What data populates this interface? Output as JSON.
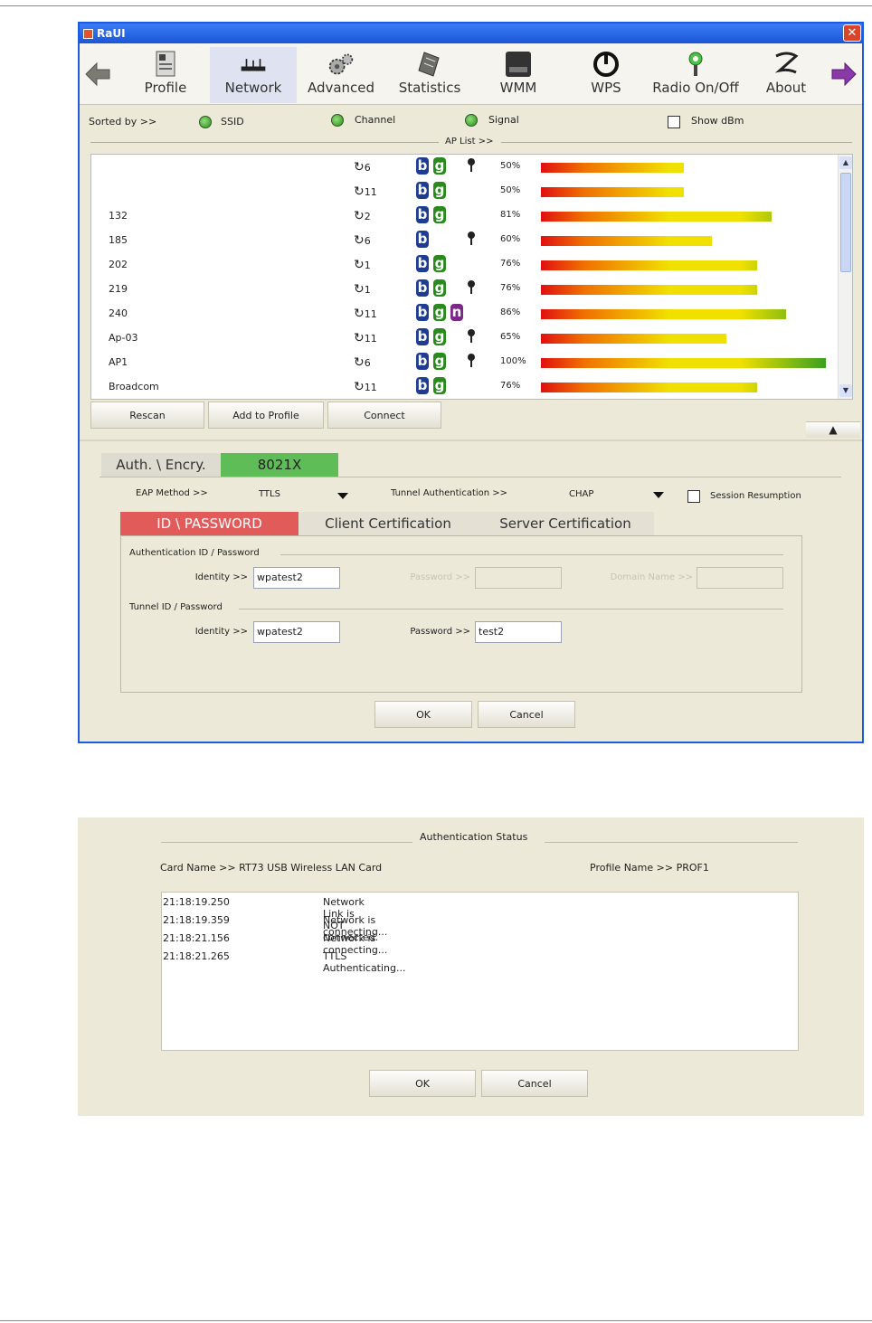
{
  "window": {
    "title": "RaUI",
    "close_glyph": "✕"
  },
  "toolbar": {
    "items": [
      {
        "label": "Profile",
        "icon": "profile-icon"
      },
      {
        "label": "Network",
        "icon": "network-icon",
        "active": true
      },
      {
        "label": "Advanced",
        "icon": "advanced-icon"
      },
      {
        "label": "Statistics",
        "icon": "statistics-icon"
      },
      {
        "label": "WMM",
        "icon": "wmm-icon"
      },
      {
        "label": "WPS",
        "icon": "wps-icon"
      },
      {
        "label": "Radio On/Off",
        "icon": "radio-icon"
      },
      {
        "label": "About",
        "icon": "about-icon"
      }
    ]
  },
  "sort": {
    "label": "Sorted by >>",
    "options": [
      "SSID",
      "Channel",
      "Signal"
    ],
    "show_dbm": "Show dBm",
    "ap_list_label": "AP List >>"
  },
  "ap_list": [
    {
      "ssid": "",
      "channel": "6",
      "modes": [
        "b",
        "g"
      ],
      "secure": true,
      "signal": "50%",
      "level": 50
    },
    {
      "ssid": "",
      "channel": "11",
      "modes": [
        "b",
        "g"
      ],
      "secure": false,
      "signal": "50%",
      "level": 50
    },
    {
      "ssid": "132",
      "channel": "2",
      "modes": [
        "b",
        "g"
      ],
      "secure": false,
      "signal": "81%",
      "level": 81
    },
    {
      "ssid": "185",
      "channel": "6",
      "modes": [
        "b"
      ],
      "secure": true,
      "signal": "60%",
      "level": 60
    },
    {
      "ssid": "202",
      "channel": "1",
      "modes": [
        "b",
        "g"
      ],
      "secure": false,
      "signal": "76%",
      "level": 76
    },
    {
      "ssid": "219",
      "channel": "1",
      "modes": [
        "b",
        "g"
      ],
      "secure": true,
      "signal": "76%",
      "level": 76
    },
    {
      "ssid": "240",
      "channel": "11",
      "modes": [
        "b",
        "g",
        "n"
      ],
      "secure": false,
      "signal": "86%",
      "level": 86
    },
    {
      "ssid": "Ap-03",
      "channel": "11",
      "modes": [
        "b",
        "g"
      ],
      "secure": true,
      "signal": "65%",
      "level": 65
    },
    {
      "ssid": "AP1",
      "channel": "6",
      "modes": [
        "b",
        "g"
      ],
      "secure": true,
      "signal": "100%",
      "level": 100
    },
    {
      "ssid": "Broadcom",
      "channel": "11",
      "modes": [
        "b",
        "g"
      ],
      "secure": false,
      "signal": "76%",
      "level": 76
    }
  ],
  "buttons": {
    "rescan": "Rescan",
    "add_to_profile": "Add to Profile",
    "connect": "Connect"
  },
  "auth": {
    "tab_label": "Auth. \\ Encry.",
    "tab_value": "8021X",
    "eap_method_label": "EAP Method >>",
    "eap_method_value": "TTLS",
    "tunnel_auth_label": "Tunnel Authentication >>",
    "tunnel_auth_value": "CHAP",
    "session_resumption": "Session Resumption"
  },
  "cert_tabs": [
    "ID \\ PASSWORD",
    "Client Certification",
    "Server Certification"
  ],
  "auth_id": {
    "group_label": "Authentication ID / Password",
    "identity_label": "Identity >>",
    "identity_value": "wpatest2",
    "password_label": "Password >>",
    "password_value": "",
    "domain_label": "Domain Name >>",
    "domain_value": ""
  },
  "tunnel_id": {
    "group_label": "Tunnel ID / Password",
    "identity_label": "Identity >>",
    "identity_value": "wpatest2",
    "password_label": "Password >>",
    "password_value": "test2"
  },
  "dialog1_buttons": {
    "ok": "OK",
    "cancel": "Cancel"
  },
  "status": {
    "title": "Authentication Status",
    "card_name": "Card Name >> RT73 USB Wireless LAN Card",
    "profile_name": "Profile Name >> PROF1",
    "log": [
      {
        "time": "21:18:19.250",
        "message": "Network Link is NOT connected."
      },
      {
        "time": "21:18:19.359",
        "message": "Network is connecting..."
      },
      {
        "time": "21:18:21.156",
        "message": "Network is connecting..."
      },
      {
        "time": "21:18:21.265",
        "message": "TTLS Authenticating..."
      }
    ],
    "ok": "OK",
    "cancel": "Cancel"
  },
  "colors": {
    "titlebar": "#1b56d6",
    "active_tab": "#e25b5b",
    "auth_value": "#5fbd58",
    "badge_b": "#1d3c92",
    "badge_g": "#2a8a1e",
    "badge_n": "#7a2a86"
  }
}
